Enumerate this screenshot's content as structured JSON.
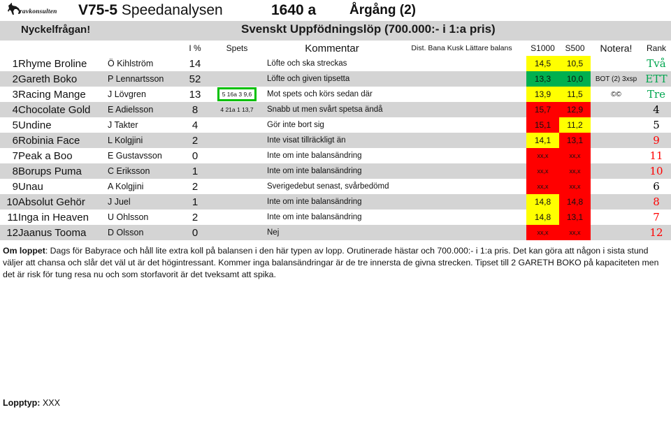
{
  "header": {
    "logo_text": "ravkonsulten",
    "logo_icon": "horse-logo-icon",
    "race_code": "V75-5",
    "race_title": "Speedanalysen",
    "distance": "1640 a",
    "vintage": "Årgång (2)",
    "key_question": "Nyckelfrågan!",
    "race_name": "Svenskt Uppfödningslöp (700.000:- i 1:a pris)"
  },
  "columns": {
    "no": "",
    "horse": "",
    "driver": "",
    "ip": "I %",
    "spets": "Spets",
    "kommentar": "Kommentar",
    "dist": "Dist. Bana Kusk Lättare balans",
    "s1000": "S1000",
    "s500": "S500",
    "notera": "Notera!",
    "rank": "Rank"
  },
  "rows": [
    {
      "no": "1",
      "horse": "Rhyme Broline",
      "driver": "Ö Kihlström",
      "ip": "14",
      "spets": "",
      "spets_boxed": false,
      "kommentar": "Löfte och ska streckas",
      "s1000": "14,5",
      "s500": "10,5",
      "s1000_bg": "yellow",
      "s500_bg": "yellow",
      "notera": "",
      "rank": "Två",
      "rank_color": "green",
      "stripe": "norm"
    },
    {
      "no": "2",
      "horse": "Gareth Boko",
      "driver": "P Lennartsson",
      "ip": "52",
      "spets": "",
      "spets_boxed": false,
      "kommentar": "Löfte och given tipsetta",
      "s1000": "13,3",
      "s500": "10,0",
      "s1000_bg": "green",
      "s500_bg": "green",
      "notera": "BOT (2) 3xsp",
      "rank": "ETT",
      "rank_color": "green",
      "stripe": "alt"
    },
    {
      "no": "3",
      "horse": "Racing Mange",
      "driver": "J Lövgren",
      "ip": "13",
      "spets": "5 16a 3 9,6",
      "spets_boxed": true,
      "kommentar": "Mot spets och körs sedan där",
      "s1000": "13,9",
      "s500": "11,5",
      "s1000_bg": "yellow",
      "s500_bg": "yellow",
      "notera": "©©",
      "rank": "Tre",
      "rank_color": "green",
      "stripe": "norm"
    },
    {
      "no": "4",
      "horse": "Chocolate Gold",
      "driver": "E Adielsson",
      "ip": "8",
      "spets": "4 21a 1 13,7",
      "spets_boxed": false,
      "kommentar": "Snabb ut men svårt spetsa ändå",
      "s1000": "15,7",
      "s500": "12,9",
      "s1000_bg": "red",
      "s500_bg": "red",
      "notera": "",
      "rank": "4",
      "rank_color": "black",
      "stripe": "alt"
    },
    {
      "no": "5",
      "horse": "Undine",
      "driver": "J Takter",
      "ip": "4",
      "spets": "",
      "spets_boxed": false,
      "kommentar": "Gör inte bort sig",
      "s1000": "15,1",
      "s500": "11,2",
      "s1000_bg": "red",
      "s500_bg": "yellow",
      "notera": "",
      "rank": "5",
      "rank_color": "black",
      "stripe": "norm"
    },
    {
      "no": "6",
      "horse": "Robinia Face",
      "driver": "L Kolgjini",
      "ip": "2",
      "spets": "",
      "spets_boxed": false,
      "kommentar": "Inte visat tillräckligt än",
      "s1000": "14,1",
      "s500": "13,1",
      "s1000_bg": "yellow",
      "s500_bg": "red",
      "notera": "",
      "rank": "9",
      "rank_color": "red",
      "stripe": "alt"
    },
    {
      "no": "7",
      "horse": "Peak a Boo",
      "driver": "E Gustavsson",
      "ip": "0",
      "spets": "",
      "spets_boxed": false,
      "kommentar": "Inte om inte balansändring",
      "s1000": "xx,x",
      "s500": "xx,x",
      "s1000_bg": "red",
      "s500_bg": "red",
      "notera": "",
      "rank": "11",
      "rank_color": "red",
      "stripe": "norm"
    },
    {
      "no": "8",
      "horse": "Borups Puma",
      "driver": "C Eriksson",
      "ip": "1",
      "spets": "",
      "spets_boxed": false,
      "kommentar": "Inte om inte balansändring",
      "s1000": "xx,x",
      "s500": "xx,x",
      "s1000_bg": "red",
      "s500_bg": "red",
      "notera": "",
      "rank": "10",
      "rank_color": "red",
      "stripe": "alt"
    },
    {
      "no": "9",
      "horse": "Unau",
      "driver": "A Kolgjini",
      "ip": "2",
      "spets": "",
      "spets_boxed": false,
      "kommentar": "Sverigedebut senast, svårbedömd",
      "s1000": "xx,x",
      "s500": "xx,x",
      "s1000_bg": "red",
      "s500_bg": "red",
      "notera": "",
      "rank": "6",
      "rank_color": "black",
      "stripe": "norm"
    },
    {
      "no": "10",
      "horse": "Absolut Gehör",
      "driver": "J Juel",
      "ip": "1",
      "spets": "",
      "spets_boxed": false,
      "kommentar": "Inte om inte balansändring",
      "s1000": "14,8",
      "s500": "14,8",
      "s1000_bg": "yellow",
      "s500_bg": "red",
      "notera": "",
      "rank": "8",
      "rank_color": "red",
      "stripe": "alt"
    },
    {
      "no": "11",
      "horse": "Inga in Heaven",
      "driver": "U Ohlsson",
      "ip": "2",
      "spets": "",
      "spets_boxed": false,
      "kommentar": "Inte om inte balansändring",
      "s1000": "14,8",
      "s500": "13,1",
      "s1000_bg": "yellow",
      "s500_bg": "red",
      "notera": "",
      "rank": "7",
      "rank_color": "red",
      "stripe": "norm"
    },
    {
      "no": "12",
      "horse": "Jaanus Tooma",
      "driver": "D Olsson",
      "ip": "0",
      "spets": "",
      "spets_boxed": false,
      "kommentar": "Nej",
      "s1000": "xx,x",
      "s500": "xx,x",
      "s1000_bg": "red",
      "s500_bg": "red",
      "notera": "",
      "rank": "12",
      "rank_color": "red",
      "stripe": "alt"
    }
  ],
  "about": {
    "label": "Om loppet",
    "text": ": Dags för Babyrace och håll lite extra koll på balansen i den här typen av lopp. Orutinerade hästar och 700.000:- i 1:a pris. Det kan göra att någon i sista stund väljer att chansa och slår det väl ut är det högintressant. Kommer inga balansändringar är de tre innersta de givna strecken. Tipset till 2 GARETH BOKO på kapaciteten men det är risk för tung resa nu och som storfavorit är det tveksamt att spika."
  },
  "footer": {
    "lopptyp_label": "Lopptyp:",
    "lopptyp_value": "XXX"
  },
  "colors": {
    "yellow": "#ffff00",
    "green": "#00b04f",
    "red": "#ff0000",
    "rank_green": "#00a64f",
    "rank_red": "#ff0000",
    "stripe": "#d4d4d4"
  }
}
